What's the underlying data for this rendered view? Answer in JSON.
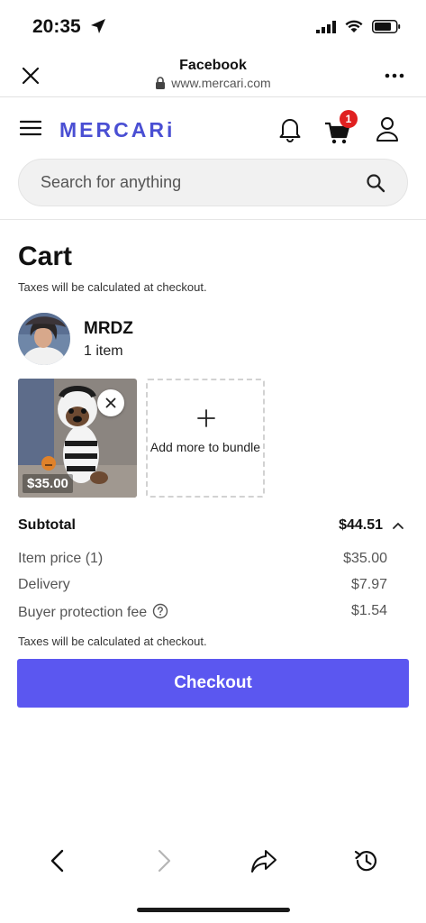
{
  "status_bar": {
    "time": "20:35"
  },
  "browser": {
    "title": "Facebook",
    "url": "www.mercari.com"
  },
  "app": {
    "logo": "MERCARi",
    "cart_badge": "1"
  },
  "search": {
    "placeholder": "Search for anything"
  },
  "cart": {
    "title": "Cart",
    "tax_note": "Taxes will be calculated at checkout.",
    "seller": {
      "name": "MRDZ",
      "item_count": "1 item"
    },
    "item": {
      "price": "$35.00"
    },
    "add_bundle_label": "Add more to bundle",
    "summary": {
      "subtotal_label": "Subtotal",
      "subtotal_value": "$44.51",
      "lines": [
        {
          "label": "Item price (1)",
          "value": "$35.00"
        },
        {
          "label": "Delivery",
          "value": "$7.97"
        },
        {
          "label": "Buyer protection fee",
          "value": "$1.54"
        }
      ],
      "tax_note": "Taxes will be calculated at checkout."
    },
    "checkout_label": "Checkout"
  },
  "colors": {
    "brand": "#4a4fd3",
    "checkout": "#5b57f0",
    "badge": "#e02020"
  },
  "icons": [
    "location-arrow-icon",
    "signal-icon",
    "wifi-icon",
    "battery-icon",
    "close-icon",
    "lock-icon",
    "more-icon",
    "hamburger-menu-icon",
    "bell-icon",
    "cart-icon",
    "account-icon",
    "search-icon",
    "remove-icon",
    "plus-icon",
    "chevron-up-icon",
    "help-icon",
    "back-arrow-icon",
    "forward-arrow-icon",
    "share-icon",
    "history-icon"
  ]
}
